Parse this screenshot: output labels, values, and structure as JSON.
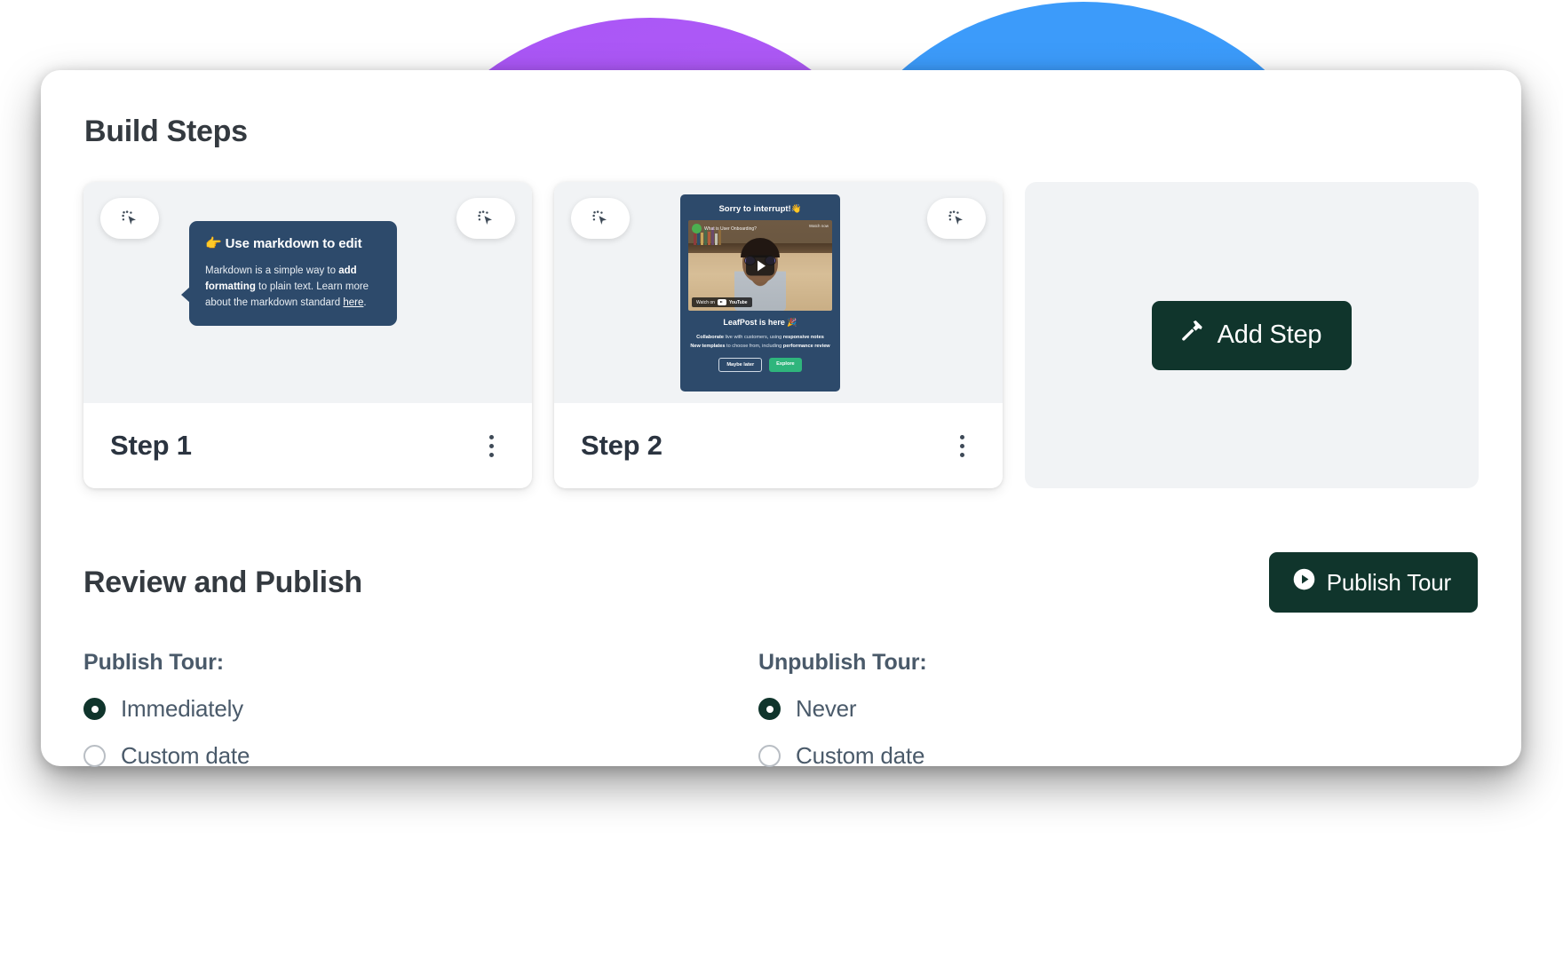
{
  "background": {
    "purple": "#a855f7",
    "blue": "#3b9bfb",
    "overlap": "#2f38ef"
  },
  "theme": {
    "accent_green": "#10352c",
    "heading_color": "#343a40",
    "label_color": "#4a5a6a",
    "card_bg": "#f1f3f5",
    "tooltip_bg": "#2d4a6b"
  },
  "sections": {
    "build_steps_title": "Build Steps",
    "review_title": "Review and Publish"
  },
  "steps": [
    {
      "label": "Step 1",
      "left_icon": "cursor-click-icon",
      "right_icon": "cursor-click-icon",
      "menu_icon": "kebab-menu-icon",
      "preview_type": "markdown-tooltip",
      "tooltip": {
        "emoji": "👉",
        "title": "Use markdown to edit",
        "body_1": "Markdown is a simple way to ",
        "body_bold_1": "add formatting",
        "body_2": " to plain text. Learn more about the markdown standard ",
        "link": "here",
        "body_3": "."
      }
    },
    {
      "label": "Step 2",
      "left_icon": "cursor-click-icon",
      "right_icon": "cursor-click-icon",
      "menu_icon": "kebab-menu-icon",
      "preview_type": "video-modal",
      "modal": {
        "heading": "Sorry to interrupt!👋",
        "video_title": "What is User Onboarding?",
        "video_watch_label": "Watch on",
        "video_watch_brand": "YouTube",
        "video_top_right": "Watch now",
        "play_icon": "play-icon",
        "subheading": "LeafPost is here 🎉",
        "line_1_bold": "Collaborate",
        "line_1_mid": " live with customers, using ",
        "line_1_bold2": "responsive notes",
        "line_2_bold": "New templates",
        "line_2_mid": " to choose from, including ",
        "line_2_bold2": "performance review",
        "btn_secondary": "Maybe later",
        "btn_primary": "Explore"
      }
    }
  ],
  "add_step": {
    "label": "Add Step",
    "icon": "hammer-icon"
  },
  "publish": {
    "label": "Publish Tour",
    "icon": "play-circle-icon"
  },
  "publish_group": {
    "label": "Publish Tour:",
    "options": [
      {
        "label": "Immediately",
        "selected": true
      },
      {
        "label": "Custom date",
        "selected": false
      }
    ]
  },
  "unpublish_group": {
    "label": "Unpublish Tour:",
    "options": [
      {
        "label": "Never",
        "selected": true
      },
      {
        "label": "Custom date",
        "selected": false
      }
    ]
  }
}
